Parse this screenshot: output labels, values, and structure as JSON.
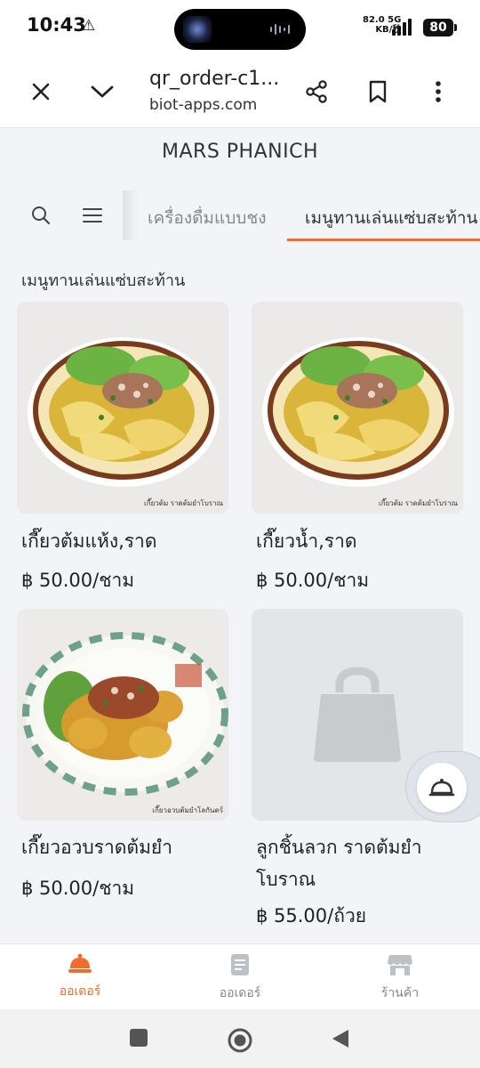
{
  "status_bar": {
    "time": "10:43",
    "net_speed": "82.0",
    "net_unit": "KB/秒",
    "net_type": "5G",
    "battery": "80"
  },
  "browser": {
    "title": "qr_order-c1...",
    "domain": "biot-apps.com",
    "icons": [
      "close-icon",
      "chevron-down-icon",
      "share-icon",
      "bookmark-icon",
      "more-vert-icon"
    ]
  },
  "store": {
    "name": "MARS PHANICH"
  },
  "category_tabs": [
    {
      "label": "เครื่องดื่มแบบชง",
      "active": false
    },
    {
      "label": "เมนูทานเล่นแซ่บสะท้าน",
      "active": true
    }
  ],
  "section_title": "เมนูทานเล่นแซ่บสะท้าน",
  "products": [
    {
      "name": "เกี๊ยวต้มแห้ง,ราด",
      "price": "฿ 50.00/ชาม",
      "image_caption": "เกี๊ยวต้ม ราดต้มยำโบราณ",
      "has_image": true
    },
    {
      "name": "เกี๊ยวน้ำ,ราด",
      "price": "฿ 50.00/ชาม",
      "image_caption": "เกี๊ยวต้ม ราดต้มยำโบราณ",
      "has_image": true
    },
    {
      "name": "เกี๊ยวอวบราดต้มยำ",
      "price": "฿ 50.00/ชาม",
      "image_caption": "เกี๊ยวอวบต้มยำโลกันตร์",
      "has_image": true
    },
    {
      "name": "ลูกชิ้นลวก ราดต้มยำโบราณ",
      "price": "฿ 55.00/ถ้วย",
      "image_caption": "",
      "has_image": false
    }
  ],
  "bottom_nav": [
    {
      "label": "ออเดอร์",
      "icon": "service-bell-icon",
      "active": true
    },
    {
      "label": "ออเดอร์",
      "icon": "receipt-icon",
      "active": false
    },
    {
      "label": "ร้านค้า",
      "icon": "store-icon",
      "active": false
    }
  ],
  "colors": {
    "accent": "#ef6c2c",
    "background": "#f2f4f7",
    "placeholder": "#e4e5e8"
  }
}
